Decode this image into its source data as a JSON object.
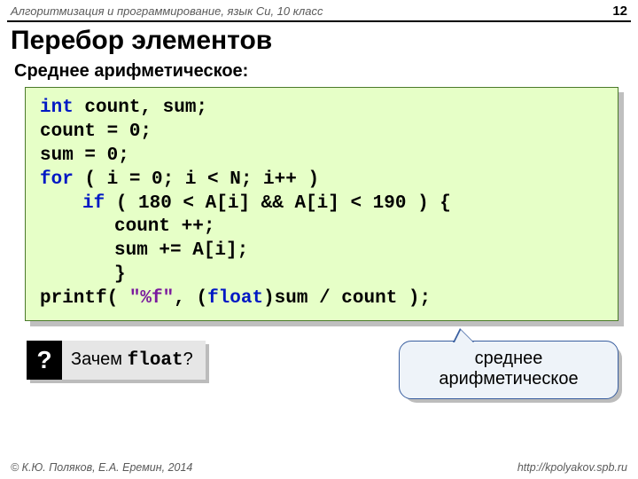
{
  "header": {
    "course": "Алгоритмизация и программирование, язык Си, 10 класс",
    "page": "12"
  },
  "title": "Перебор элементов",
  "subtitle": "Среднее арифметическое:",
  "code": {
    "l1a": "int",
    "l1b": " count, sum;",
    "l2": "count = 0;",
    "l3": "sum = 0;",
    "l4a": "for",
    "l4b": " ( i = 0; i < N; i++ )",
    "l5a": "if",
    "l5b": " ( 180 < A[i] && A[i] < 190 ) {",
    "l6": "count ++;",
    "l7": "sum += A[i];",
    "l8": "}",
    "l9a": "printf( ",
    "l9b": "\"%f\"",
    "l9c": ", (",
    "l9d": "float",
    "l9e": ")sum / count );"
  },
  "question": {
    "badge": "?",
    "text_prefix": "Зачем ",
    "text_mono": "float",
    "text_suffix": "?"
  },
  "callout": {
    "line1": "среднее",
    "line2": "арифметическое"
  },
  "footer": {
    "copyright": "© К.Ю. Поляков, Е.А. Еремин, 2014",
    "url": "http://kpolyakov.spb.ru"
  }
}
